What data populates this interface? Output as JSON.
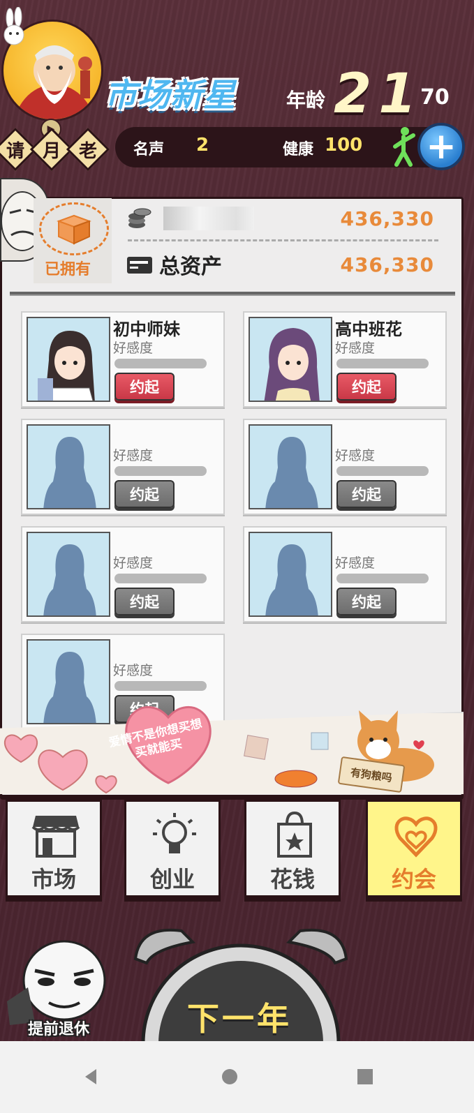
{
  "header": {
    "advisor_chars": [
      "请",
      "月",
      "老"
    ],
    "game_title": "市场新星",
    "age_label": "年龄",
    "age_value": "21",
    "age_max": "70",
    "fame_label": "名声",
    "fame_value": "2",
    "health_label": "健康",
    "health_value": "100",
    "add_symbol": "+"
  },
  "assets": {
    "owned_label": "已拥有",
    "cash_value": "436,330",
    "total_label": "总资产",
    "total_value": "436,330"
  },
  "dating": {
    "affection_label": "好感度",
    "date_label": "约起",
    "girls": [
      {
        "name": "初中师妹",
        "unlocked": true
      },
      {
        "name": "高中班花",
        "unlocked": true
      },
      {
        "name": "",
        "unlocked": false
      },
      {
        "name": "",
        "unlocked": false
      },
      {
        "name": "",
        "unlocked": false
      },
      {
        "name": "",
        "unlocked": false
      },
      {
        "name": "",
        "unlocked": false
      }
    ]
  },
  "decor": {
    "slogan": "爱情不是你想买想买就能买",
    "dog_sign": "有狗粮吗"
  },
  "tabs": [
    {
      "label": "市场",
      "icon": "store-icon",
      "active": false
    },
    {
      "label": "创业",
      "icon": "lightbulb-icon",
      "active": false
    },
    {
      "label": "花钱",
      "icon": "shopping-bag-icon",
      "active": false
    },
    {
      "label": "约会",
      "icon": "heart-icon",
      "active": true
    }
  ],
  "actions": {
    "retire_label": "提前退休",
    "next_year_label": "下一年"
  },
  "colors": {
    "background": "#4c2630",
    "accent_orange": "#e88a3a",
    "active_tab": "#fff58a",
    "date_button": "#d94452"
  }
}
